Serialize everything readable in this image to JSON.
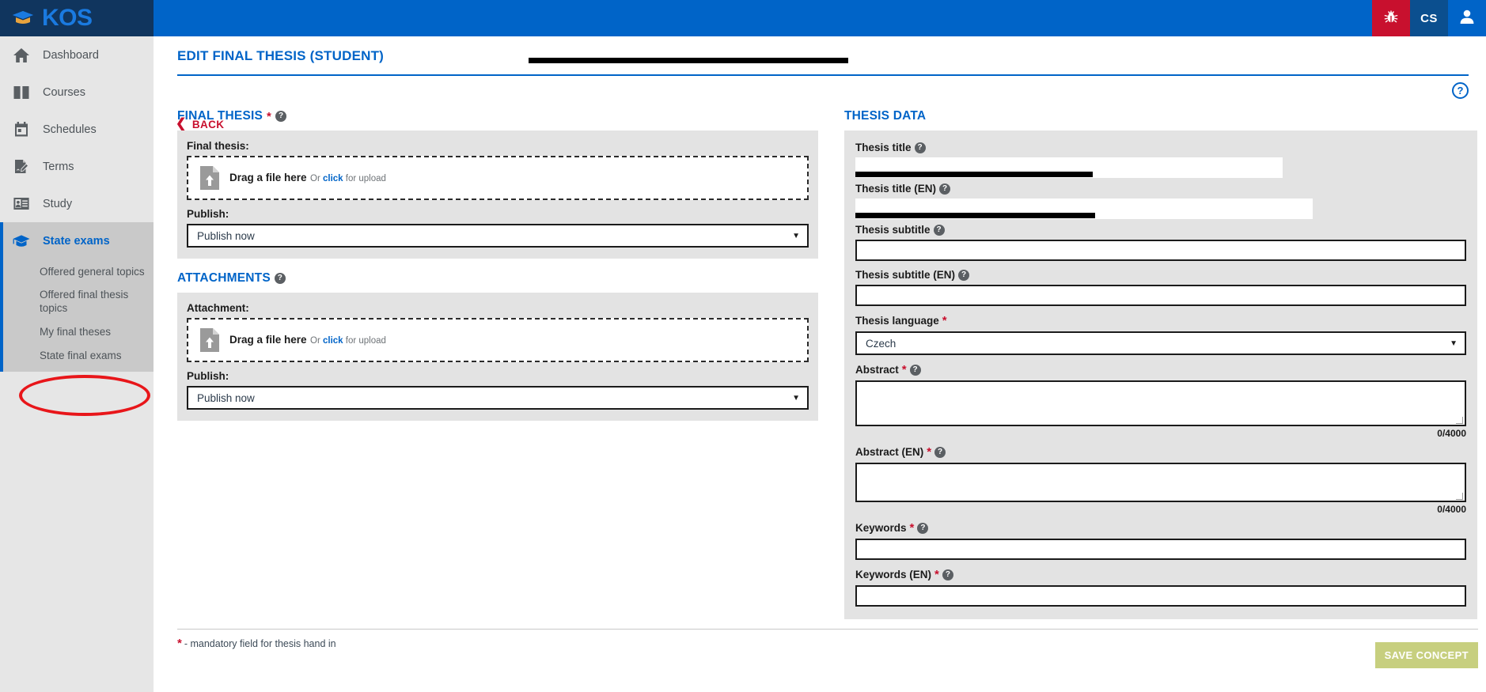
{
  "app": {
    "logo_text": "KOS",
    "logo_icon": "graduation-cap-icon"
  },
  "topbar": {
    "bug_icon": "bug-icon",
    "language": "CS",
    "user_icon": "user-avatar-icon"
  },
  "sidebar": {
    "items": [
      {
        "label": "Dashboard",
        "icon": "home-icon"
      },
      {
        "label": "Courses",
        "icon": "book-icon"
      },
      {
        "label": "Schedules",
        "icon": "calendar-icon"
      },
      {
        "label": "Terms",
        "icon": "document-pen-icon"
      },
      {
        "label": "Study",
        "icon": "id-card-icon"
      }
    ],
    "active_group": {
      "label": "State exams",
      "icon": "graduation-cap-icon",
      "sub_items": [
        {
          "label": "Offered general topics"
        },
        {
          "label": "Offered final thesis topics"
        },
        {
          "label": "My final theses",
          "annotated": true
        },
        {
          "label": "State final exams"
        }
      ]
    }
  },
  "page": {
    "title": "EDIT FINAL THESIS (STUDENT)",
    "title_redacted": true,
    "help_icon": "question-mark-circle-icon",
    "back_label": "BACK",
    "back_icon": "chevron-left-icon"
  },
  "final_thesis": {
    "section_title": "FINAL THESIS",
    "required_mark": "*",
    "help_icon": "question-mark-icon",
    "file_label": "Final thesis:",
    "dropzone": {
      "icon": "file-upload-icon",
      "main": "Drag a file here",
      "sub_prefix": "Or ",
      "sub_link": "click",
      "sub_suffix": " for upload"
    },
    "publish_label": "Publish:",
    "publish_value": "Publish now",
    "caret_icon": "chevron-down-icon"
  },
  "attachments": {
    "section_title": "ATTACHMENTS",
    "help_icon": "question-mark-icon",
    "file_label": "Attachment:",
    "dropzone": {
      "icon": "file-upload-icon",
      "main": "Drag a file here",
      "sub_prefix": "Or ",
      "sub_link": "click",
      "sub_suffix": " for upload"
    },
    "publish_label": "Publish:",
    "publish_value": "Publish now",
    "caret_icon": "chevron-down-icon"
  },
  "thesis_data": {
    "section_title": "THESIS DATA",
    "fields": {
      "title": {
        "label": "Thesis title",
        "value": "",
        "redacted": true
      },
      "title_en": {
        "label": "Thesis title (EN)",
        "value": "",
        "redacted": true
      },
      "subtitle": {
        "label": "Thesis subtitle",
        "value": ""
      },
      "subtitle_en": {
        "label": "Thesis subtitle (EN)",
        "value": ""
      },
      "language": {
        "label": "Thesis language",
        "value": "Czech",
        "required": "*"
      },
      "abstract": {
        "label": "Abstract",
        "value": "",
        "required": "*",
        "counter": "0/4000"
      },
      "abstract_en": {
        "label": "Abstract (EN)",
        "value": "",
        "required": "*",
        "counter": "0/4000"
      },
      "keywords": {
        "label": "Keywords",
        "value": "",
        "required": "*"
      },
      "keywords_en": {
        "label": "Keywords (EN)",
        "value": "",
        "required": "*"
      }
    }
  },
  "footer": {
    "mandatory_note": "- mandatory field for thesis hand in",
    "mandatory_mark": "*",
    "save_label": "SAVE CONCEPT"
  },
  "colors": {
    "brand_blue": "#0064c8",
    "dark_navy": "#10355e",
    "red": "#c8102e",
    "annotation_red": "#e8161a",
    "save_button": "#c7cf7f",
    "panel_gray": "#e3e3e3",
    "sidebar_gray": "#e6e6e6",
    "sidebar_active_gray": "#c9c9c9"
  }
}
